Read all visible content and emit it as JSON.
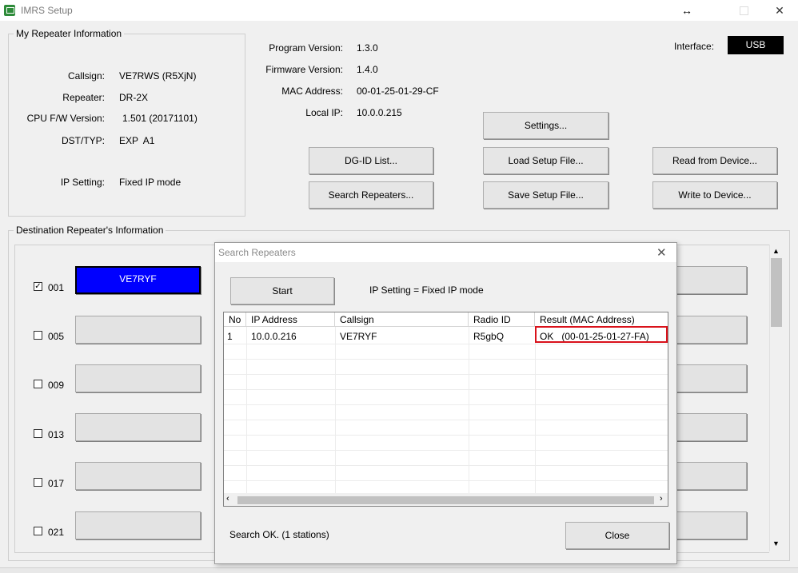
{
  "window": {
    "title": "IMRS Setup",
    "resize_icon": "↔",
    "close_icon": "✕"
  },
  "my_repeater": {
    "legend": "My Repeater Information",
    "fields": [
      {
        "label": "Callsign:",
        "value": "VE7RWS (R5XjN)"
      },
      {
        "label": "Repeater:",
        "value": "DR-2X"
      },
      {
        "label": "CPU F/W Version:",
        "value": "1.501 (20171101)"
      },
      {
        "label": "DST/TYP:",
        "value": "EXP  A1"
      },
      {
        "label": "IP Setting:",
        "value": "Fixed IP mode"
      }
    ]
  },
  "versions": [
    {
      "label": "Program Version:",
      "value": "1.3.0"
    },
    {
      "label": "Firmware Version:",
      "value": "1.4.0"
    },
    {
      "label": "MAC Address:",
      "value": "00-01-25-01-29-CF"
    },
    {
      "label": "Local IP:",
      "value": "10.0.0.215"
    }
  ],
  "interface": {
    "label": "Interface:",
    "value": "USB"
  },
  "buttons": {
    "settings": "Settings...",
    "dgid_list": "DG-ID List...",
    "load_setup": "Load Setup File...",
    "read_device": "Read from Device...",
    "search_repeaters": "Search Repeaters...",
    "save_setup": "Save Setup File...",
    "write_device": "Write to Device..."
  },
  "destination": {
    "legend": "Destination Repeater's Information",
    "slots": [
      {
        "num": "001",
        "checked": true,
        "callsign": "VE7RYF"
      },
      {
        "num": "005",
        "checked": false,
        "callsign": ""
      },
      {
        "num": "009",
        "checked": false,
        "callsign": ""
      },
      {
        "num": "013",
        "checked": false,
        "callsign": ""
      },
      {
        "num": "017",
        "checked": false,
        "callsign": ""
      },
      {
        "num": "021",
        "checked": false,
        "callsign": ""
      }
    ],
    "active_color": "#0000ff"
  },
  "dialog": {
    "title": "Search Repeaters",
    "start": "Start",
    "ip_setting": "IP Setting = Fixed IP mode",
    "columns": [
      "No",
      "IP Address",
      "Callsign",
      "Radio ID",
      "Result (MAC Address)"
    ],
    "rows": [
      {
        "no": "1",
        "ip": "10.0.0.216",
        "callsign": "VE7RYF",
        "radio_id": "R5gbQ",
        "result": "OK   (00-01-25-01-27-FA)"
      }
    ],
    "status": "Search OK. (1 stations)",
    "close": "Close",
    "highlight_color": "#d9121b"
  }
}
